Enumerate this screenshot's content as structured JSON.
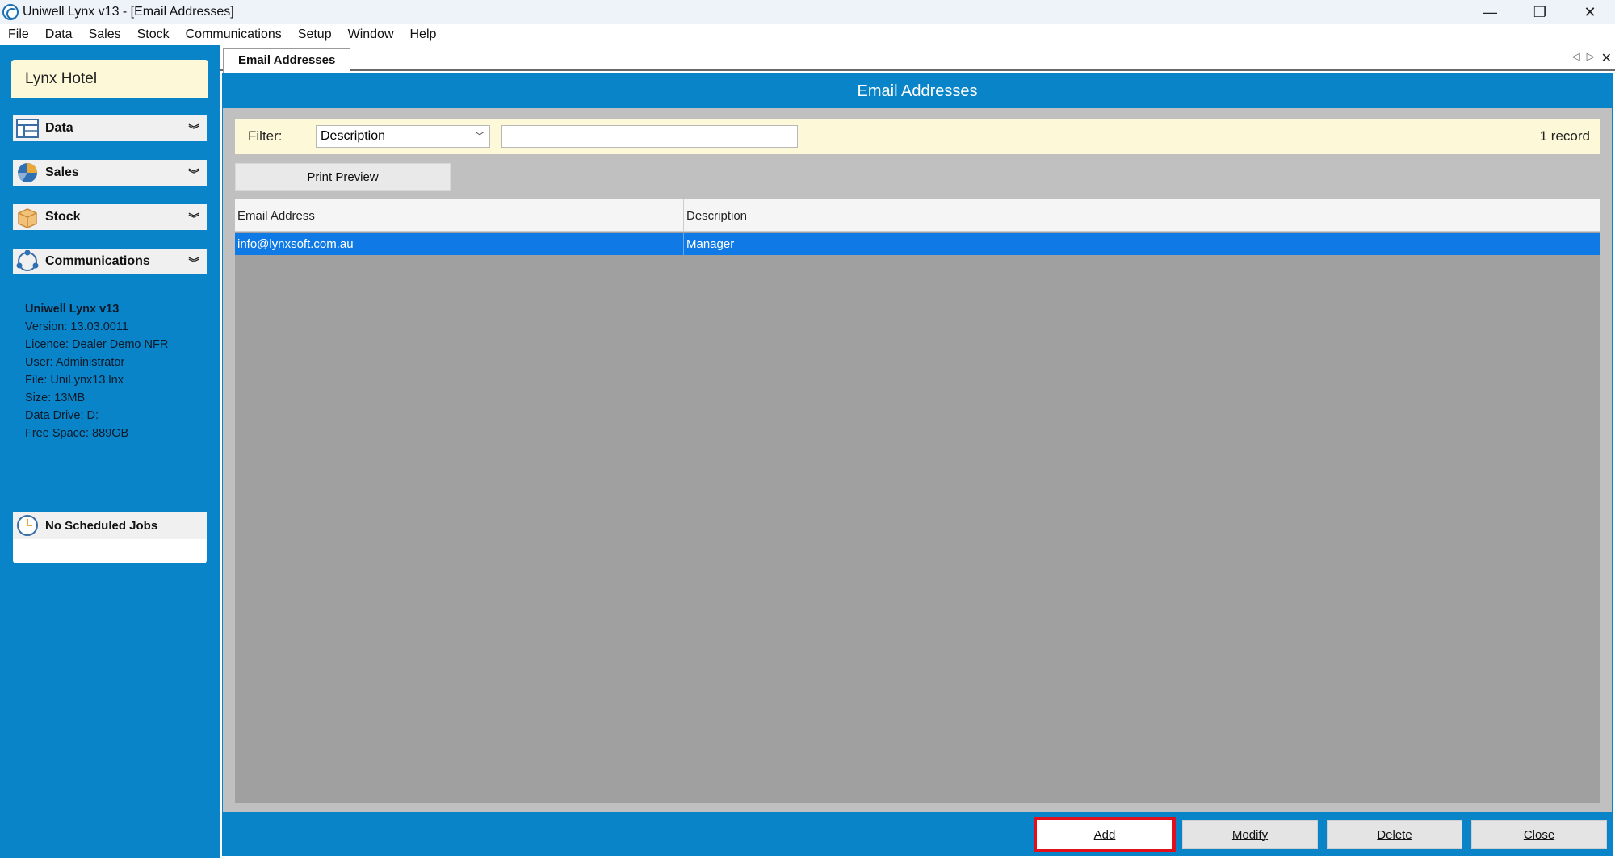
{
  "window": {
    "title": "Uniwell Lynx v13 - [Email Addresses]",
    "controls": {
      "minimize": "—",
      "restore": "❐",
      "close": "✕"
    }
  },
  "menu": [
    "File",
    "Data",
    "Sales",
    "Stock",
    "Communications",
    "Setup",
    "Window",
    "Help"
  ],
  "sidebar": {
    "hotel_name": "Lynx Hotel",
    "sections": [
      {
        "label": "Data",
        "icon": "data-table-icon"
      },
      {
        "label": "Sales",
        "icon": "pie-chart-icon"
      },
      {
        "label": "Stock",
        "icon": "box-icon"
      },
      {
        "label": "Communications",
        "icon": "network-icon"
      }
    ],
    "info": {
      "title": "Uniwell Lynx v13",
      "version": "Version: 13.03.0011",
      "licence": "Licence: Dealer Demo NFR",
      "user": "User: Administrator",
      "file": "File: UniLynx13.lnx",
      "size": "Size: 13MB",
      "data_drive": "Data Drive: D:",
      "free_space": "Free Space: 889GB"
    },
    "jobs": {
      "label": "No Scheduled Jobs",
      "icon": "clock-icon"
    }
  },
  "tabs": [
    {
      "label": "Email Addresses"
    }
  ],
  "page": {
    "header": "Email Addresses",
    "filter": {
      "label": "Filter:",
      "selected": "Description",
      "text_value": "",
      "record_count": "1 record"
    },
    "print_preview": "Print Preview",
    "columns": [
      "Email Address",
      "Description"
    ],
    "rows": [
      {
        "email": "info@lynxsoft.com.au",
        "description": "Manager"
      }
    ],
    "buttons": {
      "add": "Add",
      "modify": "Modify",
      "delete": "Delete",
      "close": "Close"
    }
  },
  "colors": {
    "accent_blue": "#0a84c8",
    "selection_blue": "#0f7ae5",
    "highlight_red": "#e0101c",
    "cream": "#fdf8d8"
  }
}
